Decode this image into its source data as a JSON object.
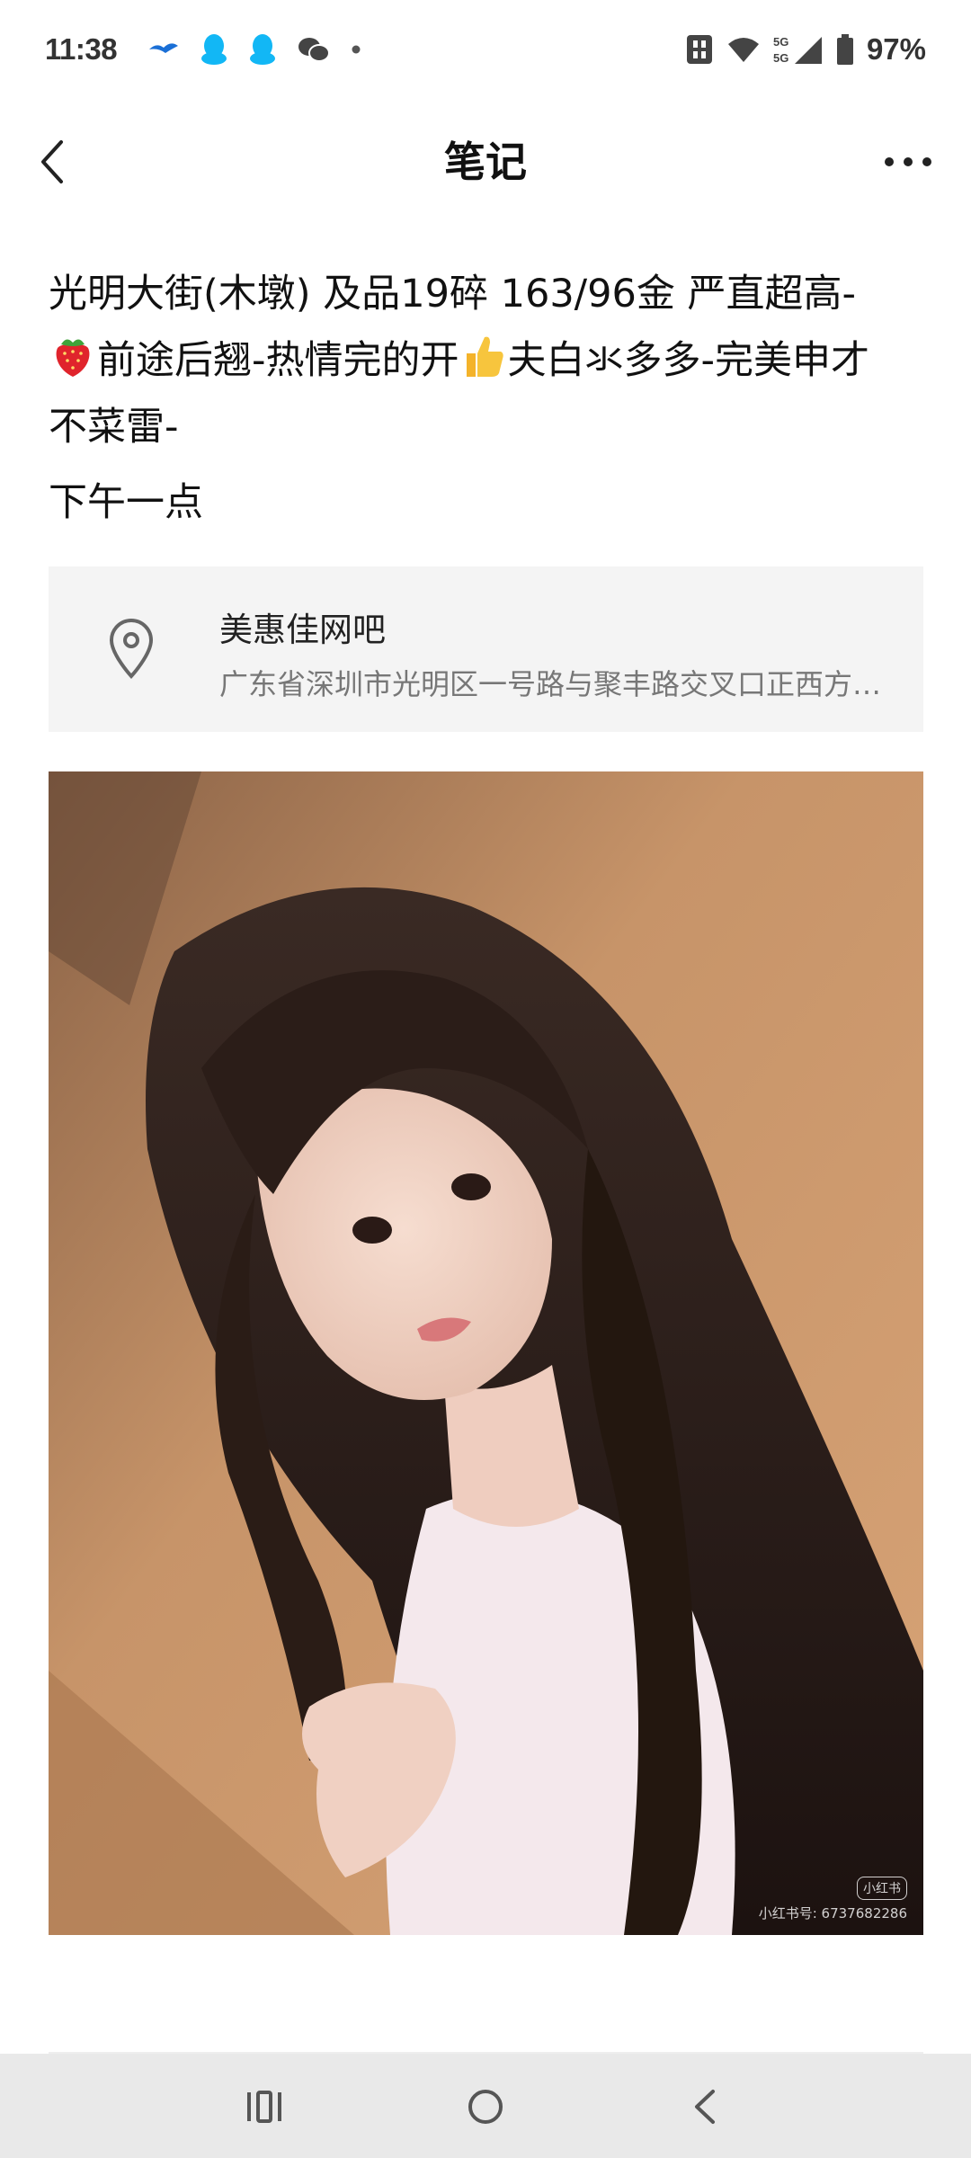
{
  "status_bar": {
    "time": "11:38",
    "battery": "97%",
    "network": "5G"
  },
  "header": {
    "title": "笔记"
  },
  "post": {
    "line1": "光明大街(木墩)  及品19碎 163/96金 严直超高-",
    "line2_part1": "前途后翘-热情完的开",
    "line2_part2": "夫白氺多多-完美申才",
    "line3": "不菜雷-",
    "time_text": "下午一点"
  },
  "location": {
    "name": "美惠佳网吧",
    "address": "广东省深圳市光明区一号路与聚丰路交叉口正西方…"
  },
  "photo": {
    "watermark_badge": "小红书",
    "watermark_id": "小红书号: 6737682286"
  },
  "colors": {
    "background": "#ffffff",
    "card_bg": "#f4f4f4",
    "nav_bg": "#e9e9e9"
  }
}
